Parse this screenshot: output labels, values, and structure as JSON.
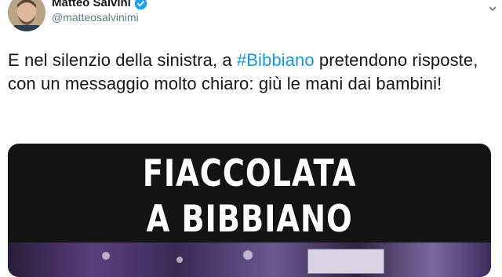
{
  "author": {
    "name": "Matteo Salvini",
    "handle": "@matteosalvinimi",
    "verified": true
  },
  "tweet": {
    "text_before": "E nel silenzio della sinistra, a ",
    "hashtag": "#Bibbiano",
    "text_after": " pretendono risposte, con un messaggio molto chiaro: giù le mani dai bambini!"
  },
  "media": {
    "headline_line1": "FIACCOLATA",
    "headline_line2": "A BIBBIANO"
  },
  "colors": {
    "link": "#1b95e0",
    "verified": "#1da1f2",
    "text": "#14171a",
    "secondary": "#657786"
  },
  "icons": {
    "verified": "verified-badge-icon",
    "menu": "chevron-down-icon"
  }
}
